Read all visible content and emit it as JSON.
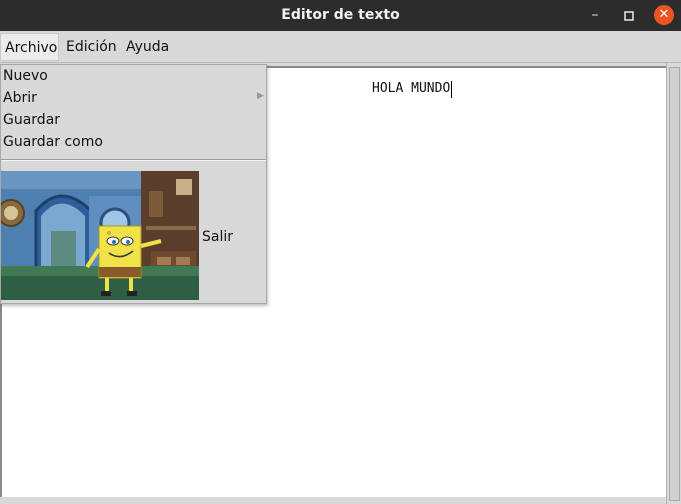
{
  "window": {
    "title": "Editor de texto",
    "controls": [
      "minimize-icon",
      "maximize-icon",
      "close-icon"
    ]
  },
  "menubar": {
    "items": [
      {
        "label": "Archivo"
      },
      {
        "label": "Edición"
      },
      {
        "label": "Ayuda"
      }
    ]
  },
  "dropdown": {
    "items": [
      {
        "label": "Nuevo"
      },
      {
        "label": "Abrir"
      },
      {
        "label": "Guardar"
      },
      {
        "label": "Guardar como"
      }
    ],
    "exit": {
      "label": "Salir",
      "image": "spongebob-image"
    }
  },
  "editor": {
    "content": "HOLA MUNDO"
  },
  "colors": {
    "titlebar": "#2c2c2c",
    "close": "#e95420",
    "chrome": "#d9d9d9"
  }
}
